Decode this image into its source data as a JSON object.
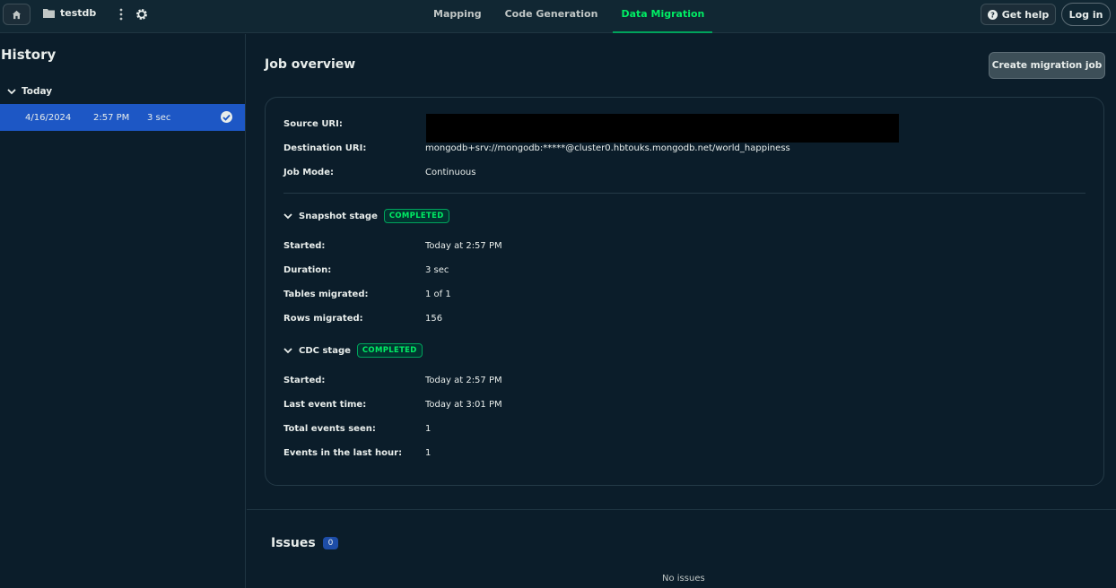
{
  "topbar": {
    "project_name": "testdb",
    "tabs": [
      {
        "label": "Mapping",
        "active": false
      },
      {
        "label": "Code Generation",
        "active": false
      },
      {
        "label": "Data Migration",
        "active": true
      }
    ],
    "help_label": "Get help",
    "login_label": "Log in"
  },
  "sidebar": {
    "title": "History",
    "group_label": "Today",
    "items": [
      {
        "date": "4/16/2024",
        "time": "2:57 PM",
        "duration": "3 sec",
        "status": "success"
      }
    ]
  },
  "main": {
    "title": "Job overview",
    "create_button": "Create migration job",
    "details": [
      {
        "label": "Source URI:",
        "value": ""
      },
      {
        "label": "Destination URI:",
        "value": "mongodb+srv://mongodb:*****@cluster0.hbtouks.mongodb.net/world_happiness"
      },
      {
        "label": "Job Mode:",
        "value": "Continuous"
      }
    ],
    "snapshot": {
      "title": "Snapshot stage",
      "status": "COMPLETED",
      "rows": [
        {
          "label": "Started:",
          "value": "Today at 2:57 PM"
        },
        {
          "label": "Duration:",
          "value": "3 sec"
        },
        {
          "label": "Tables migrated:",
          "value": "1 of 1"
        },
        {
          "label": "Rows migrated:",
          "value": "156"
        }
      ]
    },
    "cdc": {
      "title": "CDC stage",
      "status": "COMPLETED",
      "rows": [
        {
          "label": "Started:",
          "value": "Today at 2:57 PM"
        },
        {
          "label": "Last event time:",
          "value": "Today at 3:01 PM"
        },
        {
          "label": "Total events seen:",
          "value": "1"
        },
        {
          "label": "Events in the last hour:",
          "value": "1"
        }
      ]
    },
    "issues": {
      "title": "Issues",
      "count": "0",
      "empty_text": "No issues"
    }
  },
  "colors": {
    "accent_green": "#00ed64",
    "selected_blue": "#1d57c5",
    "background": "#0b1d2a"
  }
}
